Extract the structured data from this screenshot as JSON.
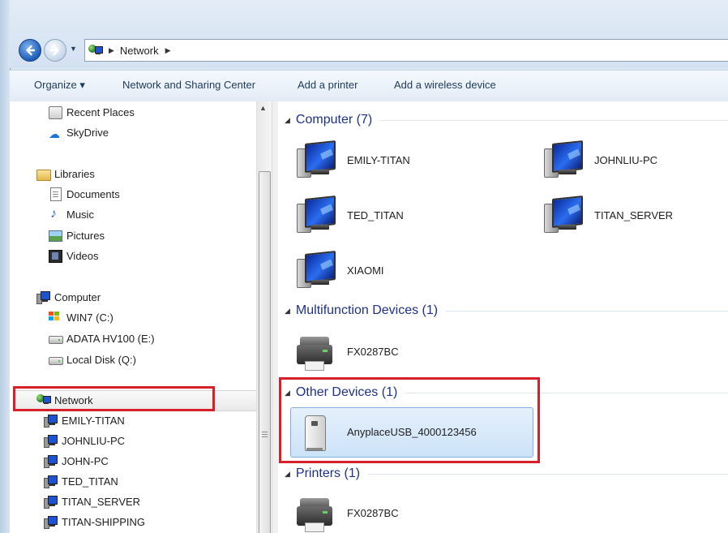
{
  "address": {
    "crumbs": [
      "Network"
    ]
  },
  "toolbar": {
    "organize": "Organize ▾",
    "network_sharing": "Network and Sharing Center",
    "add_printer": "Add a printer",
    "add_wireless": "Add a wireless device"
  },
  "nav_pane": {
    "recent_places": "Recent Places",
    "skydrive": "SkyDrive",
    "libraries": "Libraries",
    "documents": "Documents",
    "music": "Music",
    "pictures": "Pictures",
    "videos": "Videos",
    "computer": "Computer",
    "win7": "WIN7 (C:)",
    "adata": "ADATA HV100 (E:)",
    "local_disk": "Local Disk (Q:)",
    "network": "Network",
    "network_children": [
      "EMILY-TITAN",
      "JOHNLIU-PC",
      "JOHN-PC",
      "TED_TITAN",
      "TITAN_SERVER",
      "TITAN-SHIPPING"
    ]
  },
  "content": {
    "computer_group": "Computer (7)",
    "computers": [
      "EMILY-TITAN",
      "JOHNLIU-PC",
      "TED_TITAN",
      "TITAN_SERVER",
      "XIAOMI"
    ],
    "multifunction_group": "Multifunction Devices (1)",
    "multifunction": [
      "FX0287BC"
    ],
    "other_group": "Other Devices (1)",
    "other": [
      "AnyplaceUSB_4000123456"
    ],
    "printers_group": "Printers (1)",
    "printers": [
      "FX0287BC"
    ]
  },
  "colors": {
    "group_title": "#1e3287",
    "highlight_border": "#d8202a",
    "selection_fill": "#cce3f8"
  }
}
